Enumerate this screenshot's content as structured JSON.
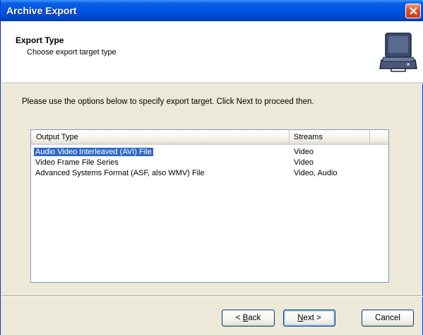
{
  "window": {
    "title": "Archive Export",
    "close_icon": "close-icon",
    "accent_color": "#0054e3"
  },
  "header": {
    "title": "Export Type",
    "subtitle": "Choose export target type",
    "icon": "export-device-icon"
  },
  "instruction": "Please use the options below to specify export target. Click Next to proceed then.",
  "list": {
    "columns": [
      "Output Type",
      "Streams",
      ""
    ],
    "rows": [
      {
        "type": "Audio Video Interleaved (AVI) File",
        "streams": "Video",
        "selected": true
      },
      {
        "type": "Video Frame File Series",
        "streams": "Video",
        "selected": false
      },
      {
        "type": "Advanced Systems Format (ASF, also WMV) File",
        "streams": "Video, Audio",
        "selected": false
      }
    ]
  },
  "buttons": {
    "back": {
      "prefix": "< ",
      "mnemonic": "B",
      "rest": "ack"
    },
    "next": {
      "mnemonic": "N",
      "rest": "ext >"
    },
    "cancel": "Cancel"
  }
}
